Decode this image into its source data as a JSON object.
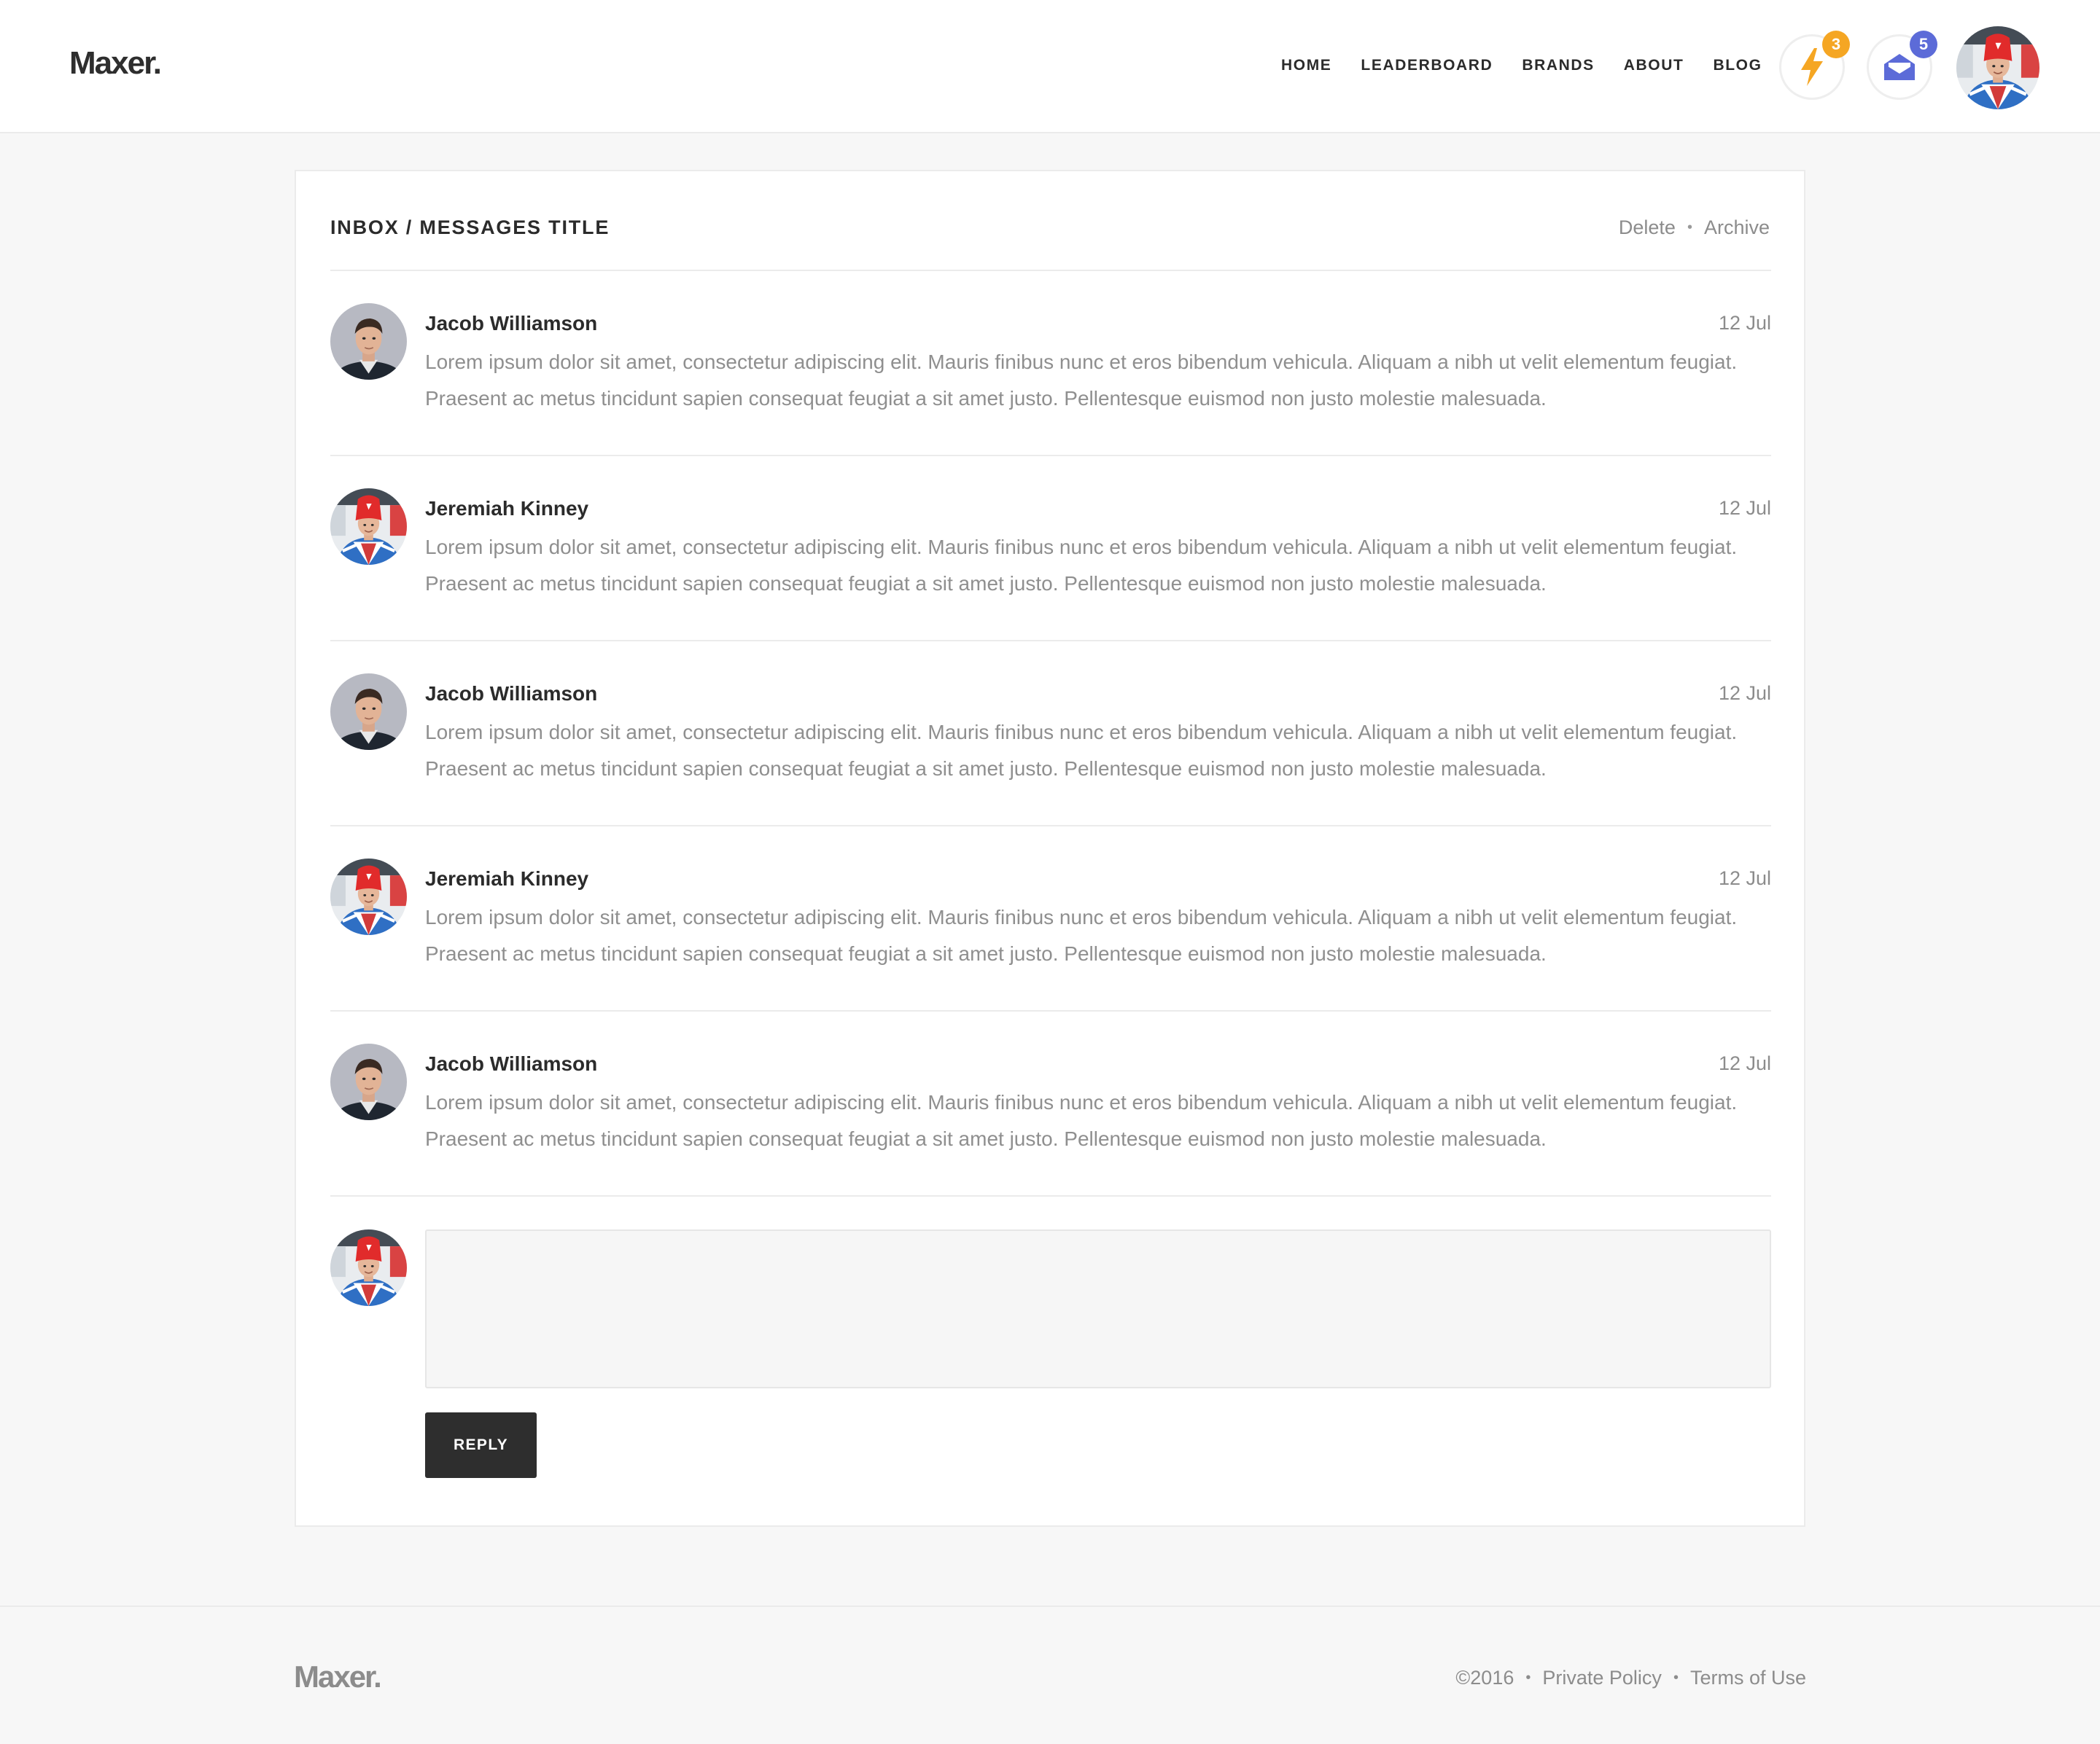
{
  "brand": {
    "logo": "Maxer."
  },
  "nav": {
    "items": [
      "HOME",
      "LEADERBOARD",
      "BRANDS",
      "ABOUT",
      "BLOG"
    ]
  },
  "notifications": {
    "activity": {
      "icon": "lightning-bolt-icon",
      "count": "3",
      "color": "#f5a623"
    },
    "messages": {
      "icon": "open-envelope-icon",
      "count": "5",
      "color": "#5c6bd8"
    }
  },
  "inbox": {
    "title": "INBOX / MESSAGES TITLE",
    "actions": {
      "delete": "Delete",
      "separator": "•",
      "archive": "Archive"
    },
    "messages": [
      {
        "sender": "Jacob Williamson",
        "avatar": "avatar-jacob",
        "date": "12 Jul",
        "body": "Lorem ipsum dolor sit amet, consectetur adipiscing elit. Mauris finibus nunc et eros bibendum vehicula. Aliquam a nibh ut velit elementum feugiat. Praesent ac metus tincidunt sapien consequat feugiat a sit amet justo. Pellentesque euismod non justo molestie malesuada."
      },
      {
        "sender": "Jeremiah Kinney",
        "avatar": "avatar-jeremiah",
        "date": "12 Jul",
        "body": "Lorem ipsum dolor sit amet, consectetur adipiscing elit. Mauris finibus nunc et eros bibendum vehicula. Aliquam a nibh ut velit elementum feugiat. Praesent ac metus tincidunt sapien consequat feugiat a sit amet justo. Pellentesque euismod non justo molestie malesuada."
      },
      {
        "sender": "Jacob Williamson",
        "avatar": "avatar-jacob",
        "date": "12 Jul",
        "body": "Lorem ipsum dolor sit amet, consectetur adipiscing elit. Mauris finibus nunc et eros bibendum vehicula. Aliquam a nibh ut velit elementum feugiat. Praesent ac metus tincidunt sapien consequat feugiat a sit amet justo. Pellentesque euismod non justo molestie malesuada."
      },
      {
        "sender": "Jeremiah Kinney",
        "avatar": "avatar-jeremiah",
        "date": "12 Jul",
        "body": "Lorem ipsum dolor sit amet, consectetur adipiscing elit. Mauris finibus nunc et eros bibendum vehicula. Aliquam a nibh ut velit elementum feugiat. Praesent ac metus tincidunt sapien consequat feugiat a sit amet justo. Pellentesque euismod non justo molestie malesuada."
      },
      {
        "sender": "Jacob Williamson",
        "avatar": "avatar-jacob",
        "date": "12 Jul",
        "body": "Lorem ipsum dolor sit amet, consectetur adipiscing elit. Mauris finibus nunc et eros bibendum vehicula. Aliquam a nibh ut velit elementum feugiat. Praesent ac metus tincidunt sapien consequat feugiat a sit amet justo. Pellentesque euismod non justo molestie malesuada."
      }
    ],
    "reply": {
      "value": "",
      "placeholder": "",
      "button_label": "REPLY"
    }
  },
  "footer": {
    "logo": "Maxer.",
    "copyright": "©2016",
    "separator": "•",
    "privacy": "Private Policy",
    "terms": "Terms of Use"
  }
}
